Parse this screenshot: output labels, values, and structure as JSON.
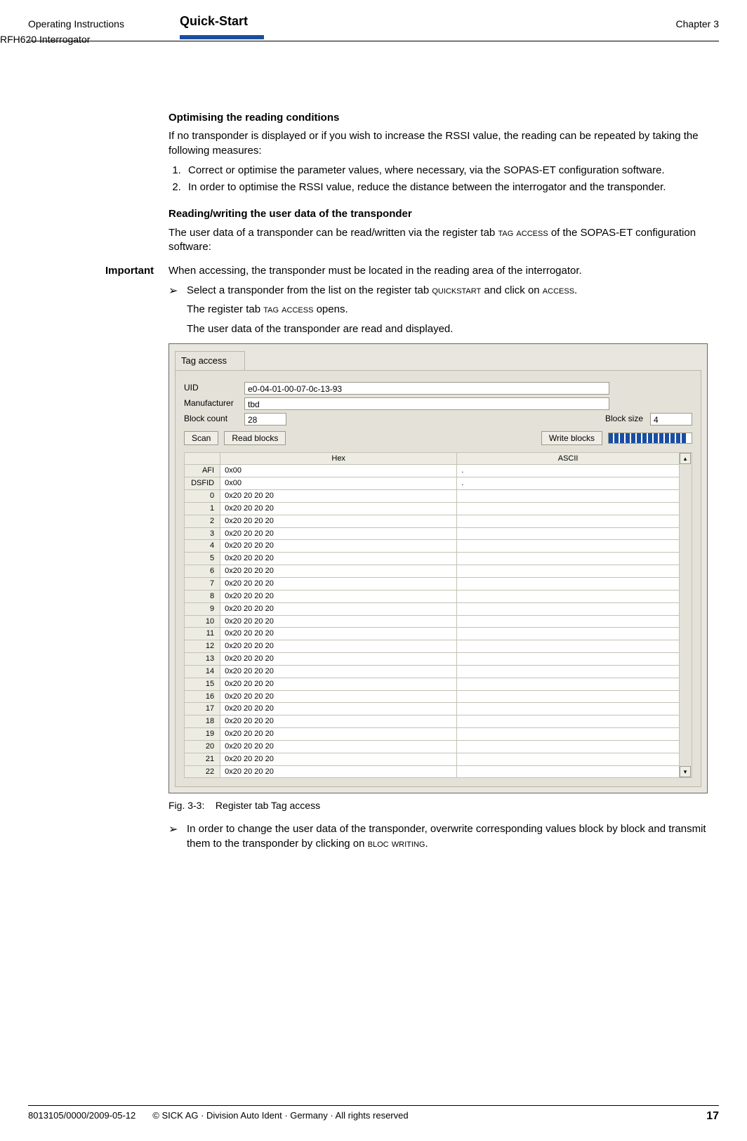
{
  "header": {
    "doc_type": "Operating Instructions",
    "product": "RFH620 Interrogator",
    "section": "Quick-Start",
    "chapter": "Chapter 3"
  },
  "body": {
    "h1": "Optimising the reading conditions",
    "p1": "If no transponder is displayed or if you wish to increase the RSSI value, the reading can be repeated by taking the following measures:",
    "ol1": [
      "Correct or optimise the parameter values, where necessary, via the SOPAS-ET configuration software.",
      "In order to optimise the RSSI value, reduce the distance between the interrogator and the transponder."
    ],
    "h2": "Reading/writing the user data of the transponder",
    "p2a": "The user data of a transponder can be read/written via the register tab ",
    "p2b_sc": "tag access",
    "p2c": " of the SOPAS-ET configuration software:",
    "important_label": "Important",
    "p3": "When accessing, the transponder must be located in the reading area of the interrogator.",
    "arrow1a": "Select a transponder from the list on the register tab ",
    "arrow1b_sc": "quickstart",
    "arrow1c": " and click on ",
    "arrow1d_sc": "access",
    "arrow1e": ".",
    "p4a": "The register tab ",
    "p4b_sc": "tag access",
    "p4c": " opens.",
    "p5": "The user data of the transponder are read and displayed.",
    "fig_caption_prefix": "Fig. 3-3:",
    "fig_caption_text": "Register tab Tag access",
    "arrow2a": "In order to change the user data of the transponder, overwrite corresponding values block by block and transmit them to the transponder by clicking on ",
    "arrow2b_sc": "bloc writing",
    "arrow2c": "."
  },
  "figure": {
    "tab_title": "Tag access",
    "uid_label": "UID",
    "uid_value": "e0-04-01-00-07-0c-13-93",
    "manuf_label": "Manufacturer",
    "manuf_value": "tbd",
    "blockcount_label": "Block count",
    "blockcount_value": "28",
    "blocksize_label": "Block size",
    "blocksize_value": "4",
    "btn_scan": "Scan",
    "btn_read": "Read blocks",
    "btn_write": "Write blocks",
    "col_hex": "Hex",
    "col_ascii": "ASCII",
    "rows": [
      {
        "idx": "AFI",
        "hex": "0x00",
        "ascii": "."
      },
      {
        "idx": "DSFID",
        "hex": "0x00",
        "ascii": "."
      },
      {
        "idx": "0",
        "hex": "0x20 20 20 20",
        "ascii": ""
      },
      {
        "idx": "1",
        "hex": "0x20 20 20 20",
        "ascii": ""
      },
      {
        "idx": "2",
        "hex": "0x20 20 20 20",
        "ascii": ""
      },
      {
        "idx": "3",
        "hex": "0x20 20 20 20",
        "ascii": ""
      },
      {
        "idx": "4",
        "hex": "0x20 20 20 20",
        "ascii": ""
      },
      {
        "idx": "5",
        "hex": "0x20 20 20 20",
        "ascii": ""
      },
      {
        "idx": "6",
        "hex": "0x20 20 20 20",
        "ascii": ""
      },
      {
        "idx": "7",
        "hex": "0x20 20 20 20",
        "ascii": ""
      },
      {
        "idx": "8",
        "hex": "0x20 20 20 20",
        "ascii": ""
      },
      {
        "idx": "9",
        "hex": "0x20 20 20 20",
        "ascii": ""
      },
      {
        "idx": "10",
        "hex": "0x20 20 20 20",
        "ascii": ""
      },
      {
        "idx": "11",
        "hex": "0x20 20 20 20",
        "ascii": ""
      },
      {
        "idx": "12",
        "hex": "0x20 20 20 20",
        "ascii": ""
      },
      {
        "idx": "13",
        "hex": "0x20 20 20 20",
        "ascii": ""
      },
      {
        "idx": "14",
        "hex": "0x20 20 20 20",
        "ascii": ""
      },
      {
        "idx": "15",
        "hex": "0x20 20 20 20",
        "ascii": ""
      },
      {
        "idx": "16",
        "hex": "0x20 20 20 20",
        "ascii": ""
      },
      {
        "idx": "17",
        "hex": "0x20 20 20 20",
        "ascii": ""
      },
      {
        "idx": "18",
        "hex": "0x20 20 20 20",
        "ascii": ""
      },
      {
        "idx": "19",
        "hex": "0x20 20 20 20",
        "ascii": ""
      },
      {
        "idx": "20",
        "hex": "0x20 20 20 20",
        "ascii": ""
      },
      {
        "idx": "21",
        "hex": "0x20 20 20 20",
        "ascii": ""
      },
      {
        "idx": "22",
        "hex": "0x20 20 20 20",
        "ascii": ""
      }
    ]
  },
  "footer": {
    "left": "8013105/0000/2009-05-12",
    "center": "© SICK AG · Division Auto Ident · Germany · All rights reserved",
    "page": "17"
  }
}
